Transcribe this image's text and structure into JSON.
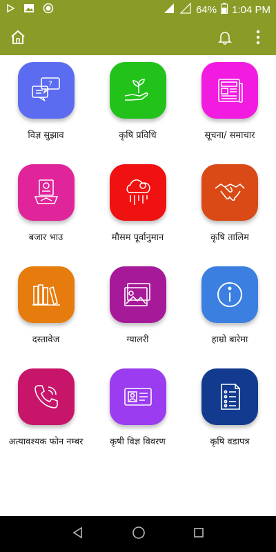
{
  "status_bar": {
    "battery": "64%",
    "time": "1:04 PM"
  },
  "app_bar": {
    "home_icon": "home-icon",
    "bell_icon": "bell-icon",
    "menu_icon": "more-vert-icon",
    "color": "#8a9c27"
  },
  "tiles": [
    {
      "label": "विज्ञ सुझाव",
      "icon": "chat-question-icon",
      "color": "#5b6cf0"
    },
    {
      "label": "कृषि प्रविधि",
      "icon": "plant-hand-icon",
      "color": "#22c21a"
    },
    {
      "label": "सूचना/ समाचार",
      "icon": "newspaper-icon",
      "color": "#f21be0"
    },
    {
      "label": "बजार भाउ",
      "icon": "market-price-icon",
      "color": "#e0259a"
    },
    {
      "label": "मौसम पूर्वानुमान",
      "icon": "weather-icon",
      "color": "#f01111"
    },
    {
      "label": "कृषि तालिम",
      "icon": "handshake-icon",
      "color": "#d94a17"
    },
    {
      "label": "दस्तावेज",
      "icon": "books-icon",
      "color": "#e67c0e"
    },
    {
      "label": "ग्यालरी",
      "icon": "gallery-icon",
      "color": "#a61a9a"
    },
    {
      "label": "हाम्रो बारेमा",
      "icon": "info-icon",
      "color": "#3b7fe0"
    },
    {
      "label": "अत्यावश्यक फोन नम्बर",
      "icon": "phone-icon",
      "color": "#c7156a"
    },
    {
      "label": "कृषी विज्ञ विवरण",
      "icon": "id-card-icon",
      "color": "#9b3cf0"
    },
    {
      "label": "कृषि वडापत्र",
      "icon": "checklist-icon",
      "color": "#123b8f"
    }
  ]
}
